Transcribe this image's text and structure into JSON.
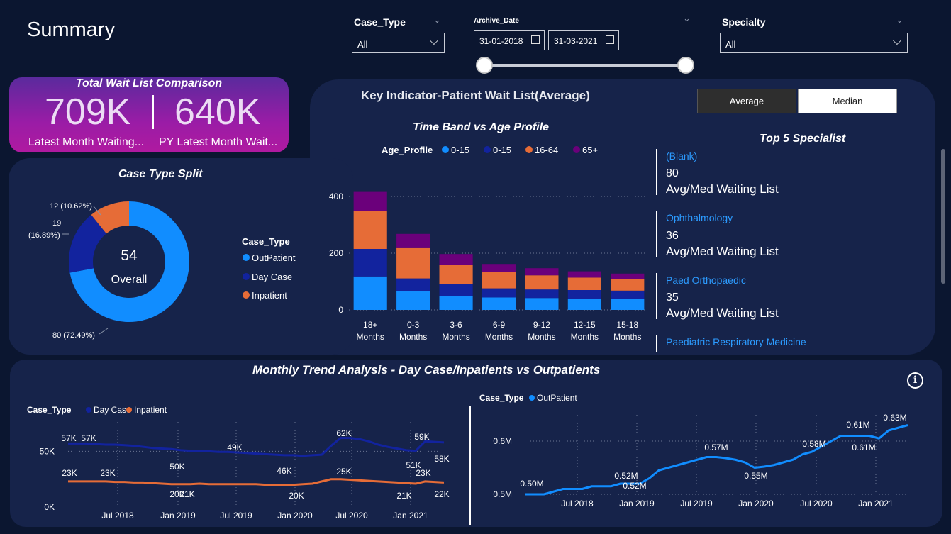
{
  "page": {
    "title": "Summary"
  },
  "filters": {
    "case_type": {
      "label": "Case_Type",
      "value": "All"
    },
    "archive_date": {
      "label": "Archive_Date",
      "start": "31-01-2018",
      "end": "31-03-2021"
    },
    "specialty": {
      "label": "Specialty",
      "value": "All"
    }
  },
  "kpi": {
    "title": "Total Wait List Comparison",
    "latest": {
      "value": "709K",
      "label": "Latest Month Waiting..."
    },
    "previous": {
      "value": "640K",
      "label": "PY Latest Month Wait..."
    }
  },
  "case_split": {
    "title": "Case Type Split",
    "center_value": "54",
    "center_label": "Overall",
    "legend_title": "Case_Type",
    "labels": {
      "outpatient": "80 (72.49%)",
      "daycase_a": "19",
      "daycase_b": "(16.89%)",
      "inpatient": "12 (10.62%)"
    }
  },
  "key_indicator": {
    "title": "Key Indicator-Patient Wait List(Average)",
    "toggle": {
      "average": "Average",
      "median": "Median"
    },
    "bar_title": "Time Band vs Age Profile",
    "legend_title": "Age_Profile",
    "top5_title": "Top 5 Specialist",
    "specialists": [
      {
        "name": "(Blank)",
        "value": "80",
        "sub": "Avg/Med Waiting List"
      },
      {
        "name": "Ophthalmology",
        "value": "36",
        "sub": "Avg/Med Waiting List"
      },
      {
        "name": "Paed Orthopaedic",
        "value": "35",
        "sub": "Avg/Med Waiting List"
      },
      {
        "name": "Paediatric Respiratory Medicine"
      }
    ]
  },
  "trend": {
    "title": "Monthly Trend Analysis - Day Case/Inpatients vs Outpatients",
    "left_legend_title": "Case_Type",
    "right_legend_title": "Case_Type"
  },
  "colors": {
    "outpatient": "#118dff",
    "daycase": "#12239e",
    "inpatient": "#e66c37",
    "age65": "#6b007b",
    "kpi_gradient_top": "#5a2a9d",
    "kpi_gradient_bottom": "#b01aa0"
  },
  "chart_data": [
    {
      "type": "pie",
      "title": "Case Type Split",
      "categories": [
        "OutPatient",
        "Day Case",
        "Inpatient"
      ],
      "values": [
        80,
        19,
        12
      ],
      "percent_labels": [
        "80 (72.49%)",
        "19 (16.89%)",
        "12 (10.62%)"
      ],
      "center_value": 54,
      "legend_placement": "right"
    },
    {
      "type": "bar",
      "stacked": true,
      "title": "Time Band vs Age Profile",
      "categories": [
        "18+ Months",
        "0-3 Months",
        "3-6 Months",
        "6-9 Months",
        "9-12 Months",
        "12-15 Months",
        "15-18 Months"
      ],
      "series": [
        {
          "name": "0-15",
          "values": [
            118,
            67,
            50,
            44,
            42,
            40,
            39
          ]
        },
        {
          "name": "0-15",
          "values": [
            97,
            44,
            40,
            32,
            30,
            30,
            29
          ]
        },
        {
          "name": "16-64",
          "values": [
            135,
            107,
            70,
            58,
            50,
            44,
            40
          ]
        },
        {
          "name": "65+",
          "values": [
            66,
            50,
            37,
            28,
            25,
            22,
            20
          ]
        }
      ],
      "yticks": [
        0,
        200,
        400
      ],
      "ylim": [
        0,
        430
      ],
      "grid": true,
      "legend_placement": "top"
    },
    {
      "type": "line",
      "x_ticks": [
        "Jul 2018",
        "Jan 2019",
        "Jul 2019",
        "Jan 2020",
        "Jul 2020",
        "Jan 2021"
      ],
      "y_ticks": [
        "0K",
        "50K"
      ],
      "ylim": [
        0,
        70000
      ],
      "x": [
        "2018-01",
        "2018-02",
        "2018-03",
        "2018-04",
        "2018-05",
        "2018-06",
        "2018-07",
        "2018-08",
        "2018-09",
        "2018-10",
        "2018-11",
        "2018-12",
        "2019-01",
        "2019-02",
        "2019-03",
        "2019-04",
        "2019-05",
        "2019-06",
        "2019-07",
        "2019-08",
        "2019-09",
        "2019-10",
        "2019-11",
        "2019-12",
        "2020-01",
        "2020-02",
        "2020-03",
        "2020-04",
        "2020-05",
        "2020-06",
        "2020-07",
        "2020-08",
        "2020-09",
        "2020-10",
        "2020-11",
        "2020-12",
        "2021-01",
        "2021-02",
        "2021-03"
      ],
      "series": [
        {
          "name": "Day Case",
          "values": [
            57000,
            57000,
            57000,
            56500,
            56000,
            56000,
            55500,
            55000,
            54000,
            53000,
            52500,
            52000,
            51000,
            50500,
            50000,
            50000,
            49500,
            49500,
            49000,
            48500,
            48000,
            47500,
            47000,
            46500,
            46500,
            46000,
            46500,
            47000,
            55000,
            62000,
            62000,
            61000,
            59000,
            56000,
            54000,
            52500,
            51000,
            50500,
            59000,
            58500,
            58000
          ]
        },
        {
          "name": "Inpatient",
          "values": [
            23000,
            23000,
            23000,
            23000,
            23000,
            22500,
            22500,
            22000,
            22000,
            21500,
            21000,
            20500,
            20500,
            20500,
            21000,
            20500,
            20500,
            20500,
            20500,
            20500,
            20500,
            20000,
            20000,
            20000,
            20000,
            20500,
            21000,
            23000,
            25000,
            25000,
            24500,
            24000,
            23500,
            23000,
            22500,
            22000,
            21500,
            21000,
            23000,
            22500,
            22000
          ]
        }
      ],
      "data_labels": [
        "57K",
        "57K",
        "50K",
        "49K",
        "46K",
        "62K",
        "59K",
        "51K",
        "58K",
        "23K",
        "23K",
        "21K",
        "20K",
        "20K",
        "25K",
        "21K",
        "23K",
        "22K"
      ],
      "legend_placement": "top-left"
    },
    {
      "type": "line",
      "x_ticks": [
        "Jul 2018",
        "Jan 2019",
        "Jul 2019",
        "Jan 2020",
        "Jul 2020",
        "Jan 2021"
      ],
      "y_ticks": [
        "0.5M",
        "0.6M"
      ],
      "series": [
        {
          "name": "OutPatient",
          "values": [
            0.5,
            0.5,
            0.5,
            0.505,
            0.51,
            0.51,
            0.51,
            0.515,
            0.515,
            0.515,
            0.52,
            0.52,
            0.52,
            0.53,
            0.545,
            0.55,
            0.555,
            0.56,
            0.565,
            0.57,
            0.57,
            0.568,
            0.565,
            0.56,
            0.55,
            0.552,
            0.555,
            0.56,
            0.565,
            0.575,
            0.58,
            0.59,
            0.6,
            0.61,
            0.61,
            0.61,
            0.61,
            0.605,
            0.62,
            0.625,
            0.63
          ]
        }
      ],
      "data_labels": [
        "0.50M",
        "0.52M",
        "0.52M",
        "0.57M",
        "0.55M",
        "0.58M",
        "0.61M",
        "0.61M",
        "0.63M"
      ],
      "legend_placement": "top-left"
    }
  ]
}
